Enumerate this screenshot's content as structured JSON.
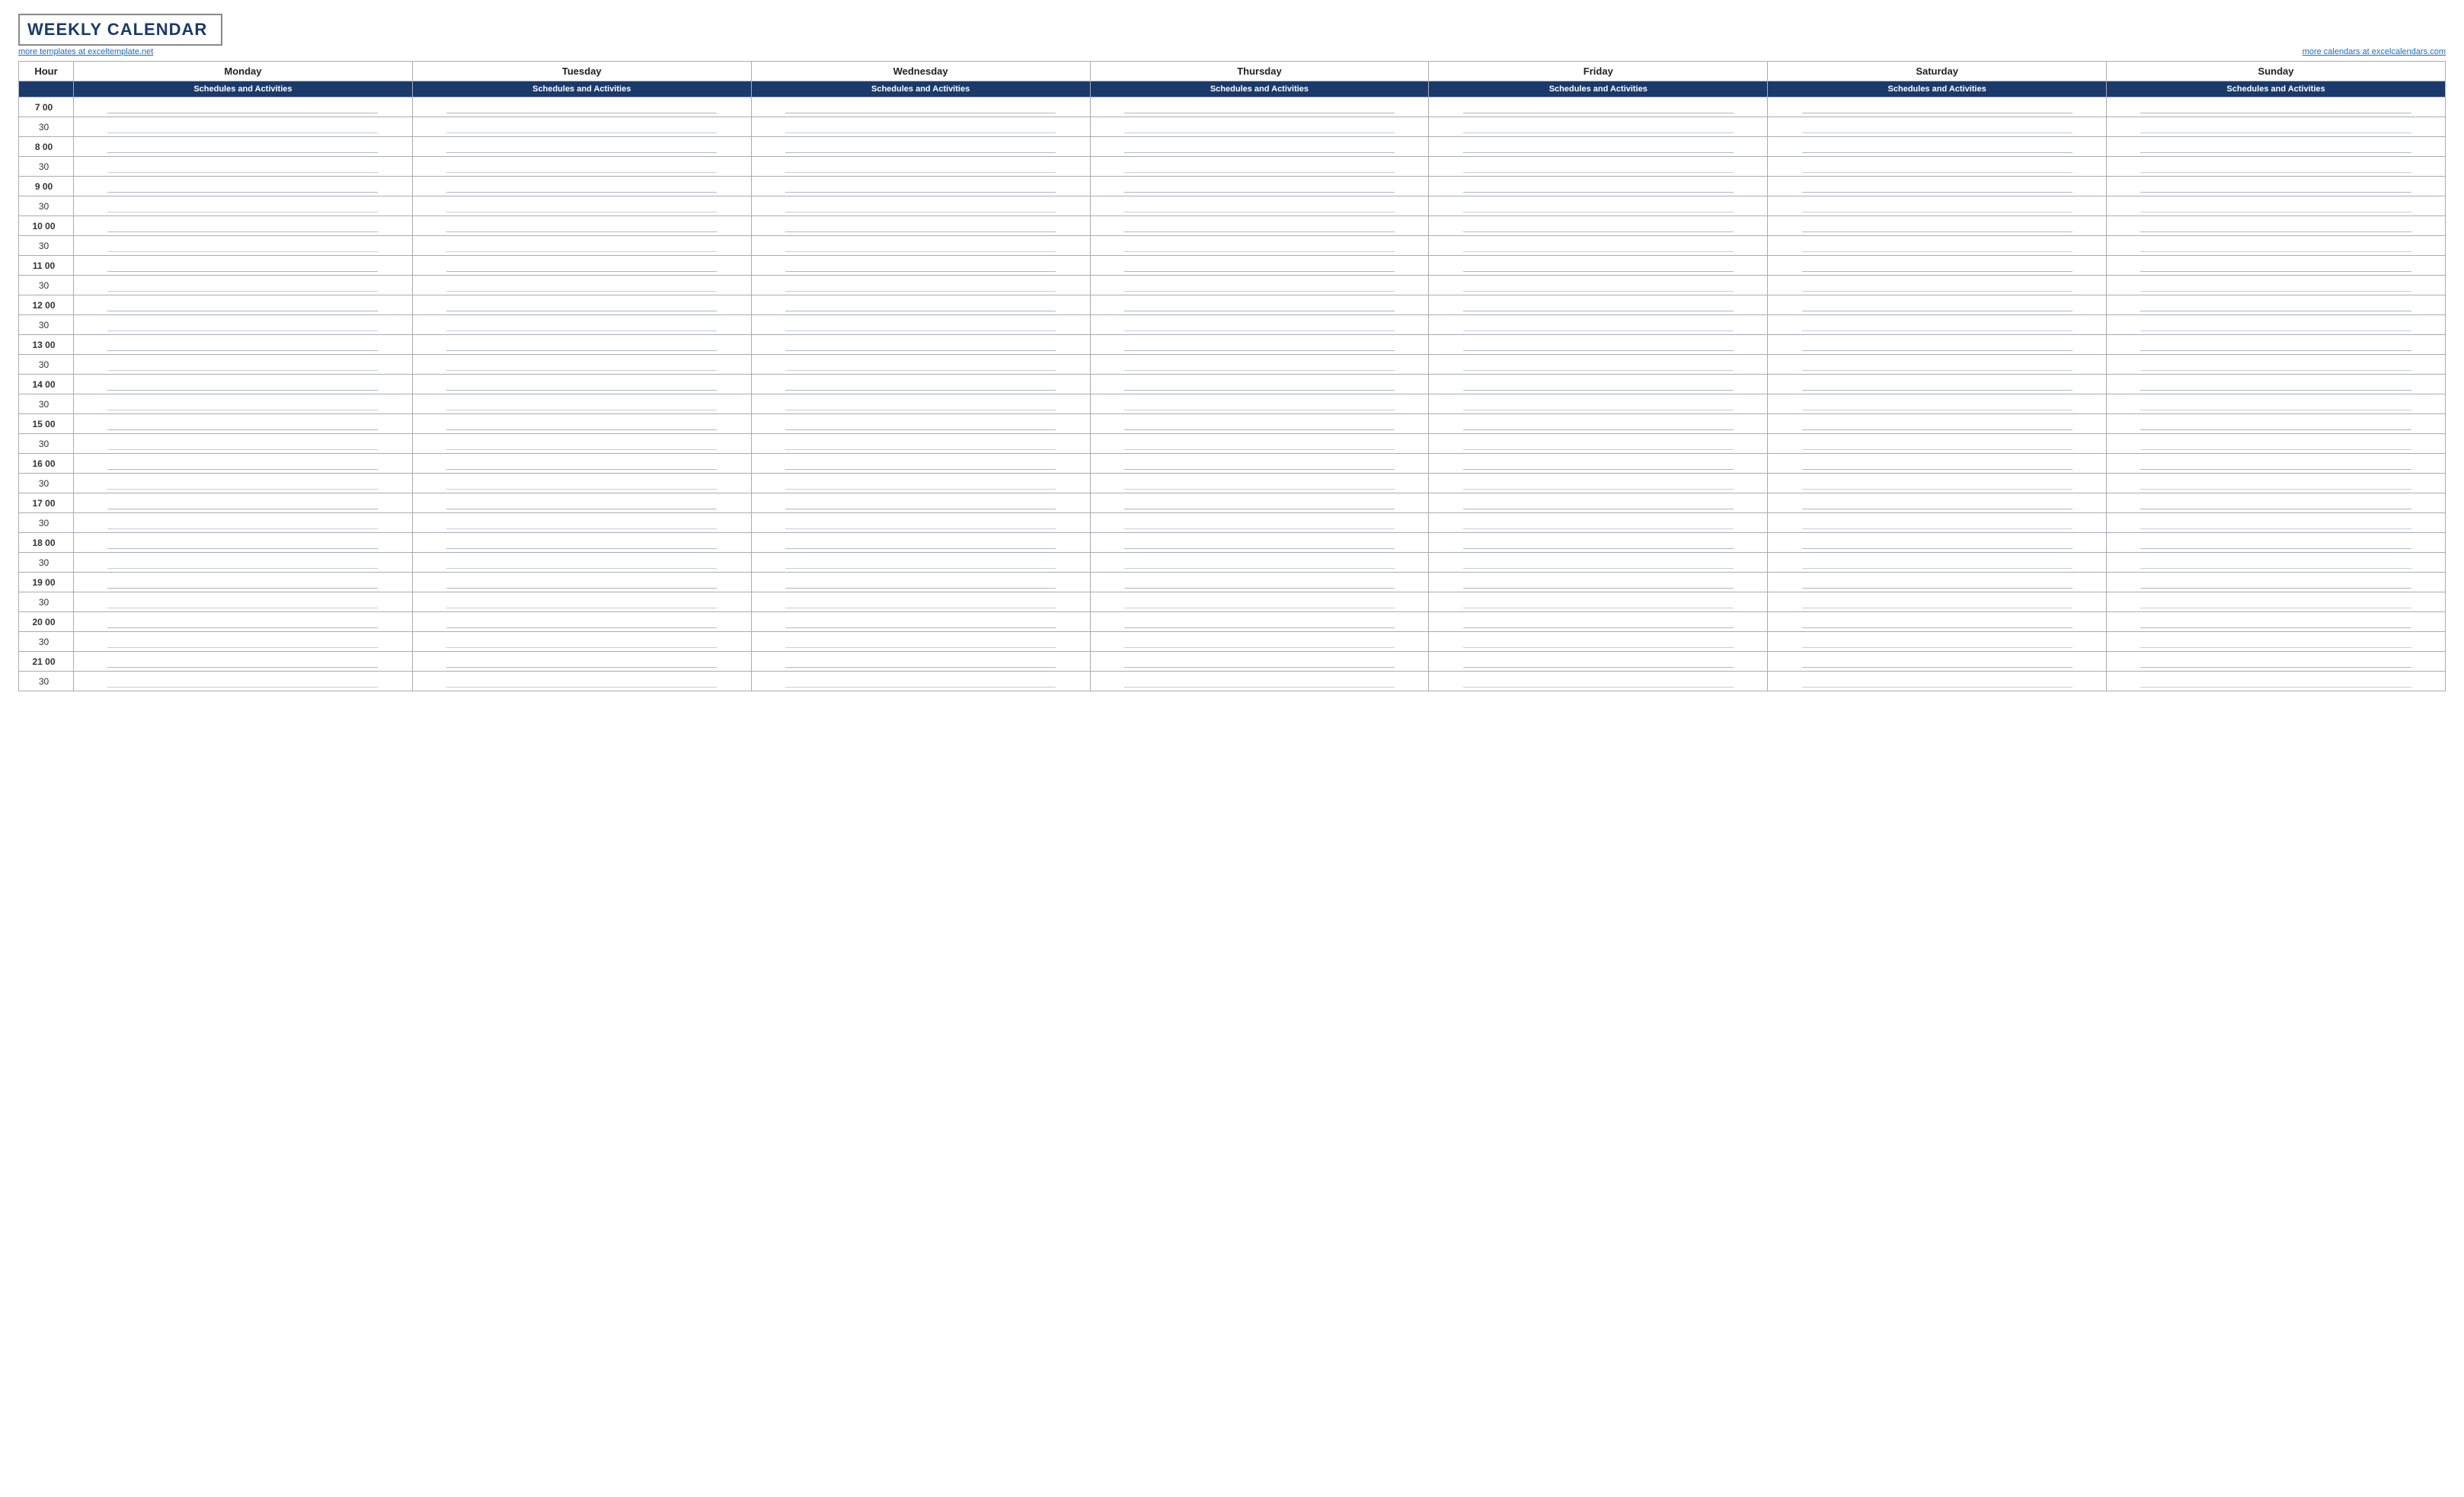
{
  "header": {
    "title": "WEEKLY CALENDAR",
    "link_left": "more templates at exceltemplate.net",
    "link_right": "more calendars at excelcalendars.com"
  },
  "col_hour_label": "Hour",
  "sub_header": "Schedules and Activities",
  "days": [
    "Monday",
    "Tuesday",
    "Wednesday",
    "Thursday",
    "Friday",
    "Saturday",
    "Sunday"
  ],
  "time_slots": [
    {
      "label": "7  00",
      "is_hour": true
    },
    {
      "label": "30",
      "is_hour": false
    },
    {
      "label": "8  00",
      "is_hour": true
    },
    {
      "label": "30",
      "is_hour": false
    },
    {
      "label": "9  00",
      "is_hour": true
    },
    {
      "label": "30",
      "is_hour": false
    },
    {
      "label": "10  00",
      "is_hour": true
    },
    {
      "label": "30",
      "is_hour": false
    },
    {
      "label": "11  00",
      "is_hour": true
    },
    {
      "label": "30",
      "is_hour": false
    },
    {
      "label": "12  00",
      "is_hour": true
    },
    {
      "label": "30",
      "is_hour": false
    },
    {
      "label": "13  00",
      "is_hour": true
    },
    {
      "label": "30",
      "is_hour": false
    },
    {
      "label": "14  00",
      "is_hour": true
    },
    {
      "label": "30",
      "is_hour": false
    },
    {
      "label": "15  00",
      "is_hour": true
    },
    {
      "label": "30",
      "is_hour": false
    },
    {
      "label": "16  00",
      "is_hour": true
    },
    {
      "label": "30",
      "is_hour": false
    },
    {
      "label": "17  00",
      "is_hour": true
    },
    {
      "label": "30",
      "is_hour": false
    },
    {
      "label": "18  00",
      "is_hour": true
    },
    {
      "label": "30",
      "is_hour": false
    },
    {
      "label": "19  00",
      "is_hour": true
    },
    {
      "label": "30",
      "is_hour": false
    },
    {
      "label": "20  00",
      "is_hour": true
    },
    {
      "label": "30",
      "is_hour": false
    },
    {
      "label": "21  00",
      "is_hour": true
    },
    {
      "label": "30",
      "is_hour": false
    }
  ]
}
